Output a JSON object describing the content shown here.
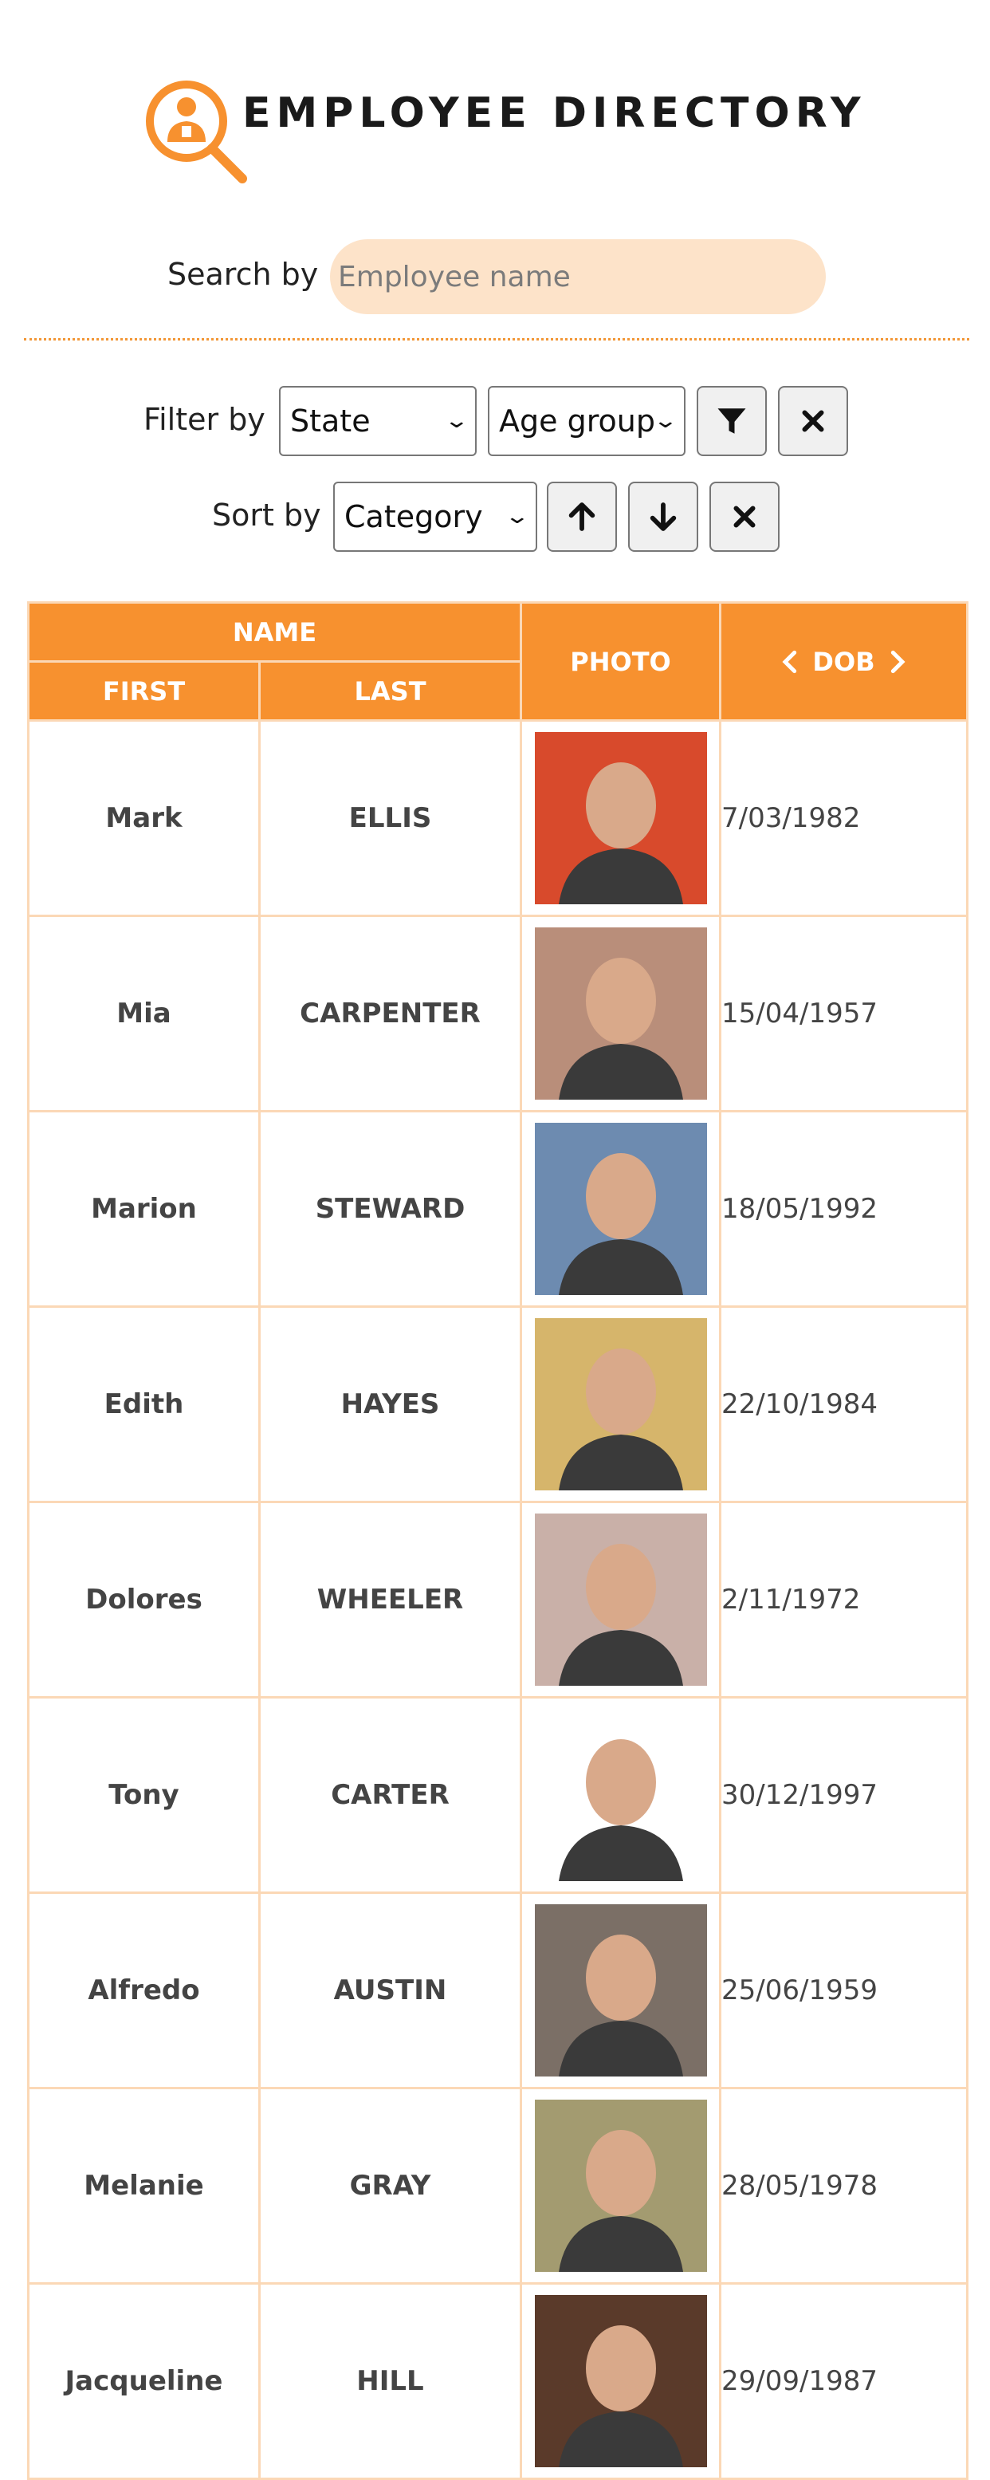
{
  "app": {
    "title": "EMPLOYEE DIRECTORY"
  },
  "search": {
    "label": "Search by",
    "placeholder": "Employee name",
    "value": ""
  },
  "filter": {
    "label": "Filter by",
    "state_select": "State",
    "age_select": "Age group",
    "apply_icon": "filter-icon",
    "clear_icon": "close-icon"
  },
  "sort": {
    "label": "Sort by",
    "category_select": "Category",
    "asc_icon": "arrow-up-icon",
    "desc_icon": "arrow-down-icon",
    "clear_icon": "close-icon"
  },
  "table": {
    "headers": {
      "name": "NAME",
      "first": "FIRST",
      "last": "LAST",
      "photo": "PHOTO",
      "dob": "DOB"
    },
    "rows": [
      {
        "first": "Mark",
        "last": "ELLIS",
        "dob": "7/03/1982"
      },
      {
        "first": "Mia",
        "last": "CARPENTER",
        "dob": "15/04/1957"
      },
      {
        "first": "Marion",
        "last": "STEWARD",
        "dob": "18/05/1992"
      },
      {
        "first": "Edith",
        "last": "HAYES",
        "dob": "22/10/1984"
      },
      {
        "first": "Dolores",
        "last": "WHEELER",
        "dob": "2/11/1972"
      },
      {
        "first": "Tony",
        "last": "CARTER",
        "dob": "30/12/1997"
      },
      {
        "first": "Alfredo",
        "last": "AUSTIN",
        "dob": "25/06/1959"
      },
      {
        "first": "Melanie",
        "last": "GRAY",
        "dob": "28/05/1978"
      },
      {
        "first": "Jacqueline",
        "last": "HILL",
        "dob": "29/09/1987"
      }
    ]
  },
  "colors": {
    "accent": "#f7912f",
    "search_bg": "#fde3c9",
    "row_border": "#fbd8b6"
  }
}
